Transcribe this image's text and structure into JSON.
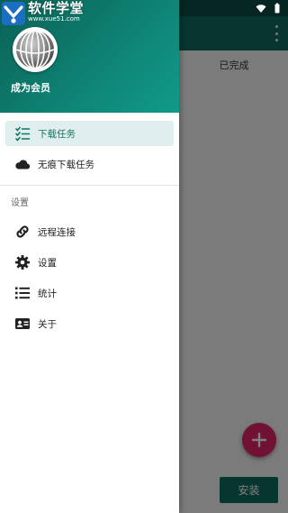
{
  "background": {
    "tab_label": "已完成",
    "install_button": "安装",
    "fab_icon": "plus-icon"
  },
  "watermark": {
    "title": "软件学堂",
    "url": "www.xue51.com"
  },
  "drawer": {
    "header": {
      "member_label": "成为会员",
      "avatar_icon": "avatar-sphere-icon"
    },
    "nav_items": [
      {
        "label": "下载任务",
        "icon": "task-list-icon",
        "active": true
      },
      {
        "label": "无痕下载任务",
        "icon": "cloud-icon",
        "active": false
      }
    ],
    "section_title": "设置",
    "settings_items": [
      {
        "label": "远程连接",
        "icon": "link-icon"
      },
      {
        "label": "设置",
        "icon": "gear-icon"
      },
      {
        "label": "统计",
        "icon": "list-icon"
      },
      {
        "label": "关于",
        "icon": "id-card-icon"
      }
    ]
  },
  "colors": {
    "primary": "#0f6d61",
    "accent": "#e32366",
    "active_bg": "#e0efed"
  }
}
